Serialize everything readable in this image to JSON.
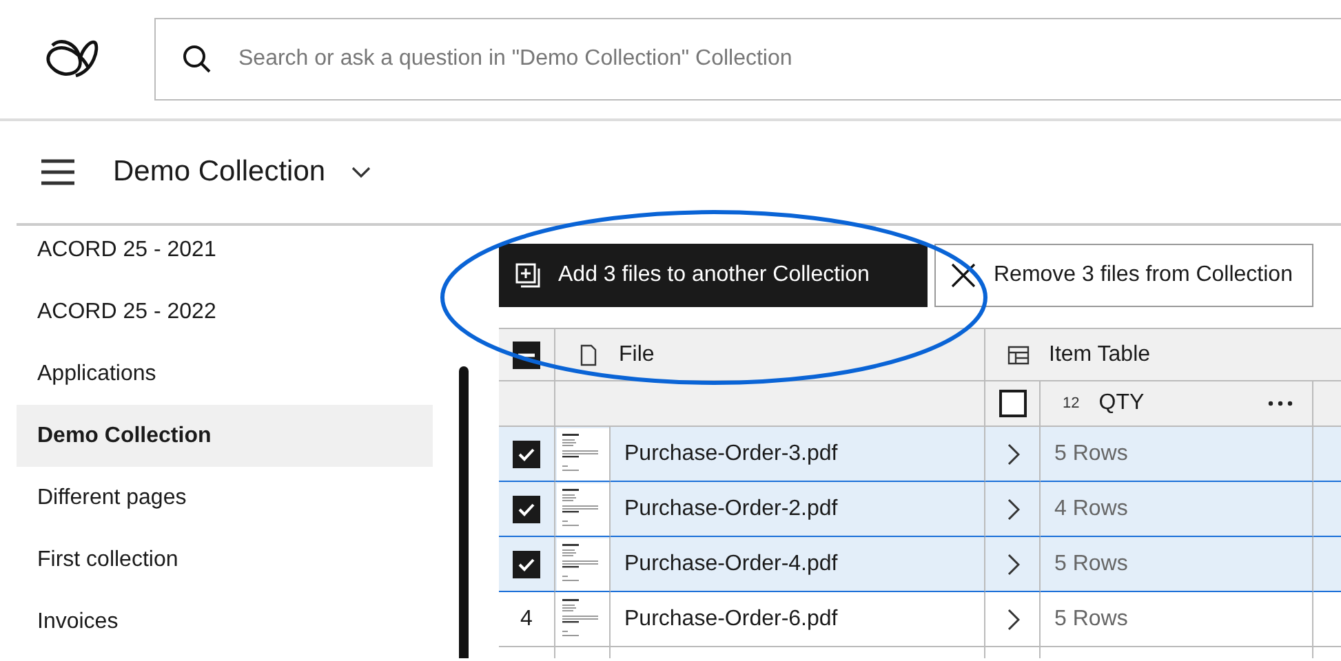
{
  "search": {
    "placeholder": "Search or ask a question in \"Demo Collection\" Collection"
  },
  "collection_title": "Demo Collection",
  "sidebar": {
    "items": [
      {
        "label": "ACORD 25 - 2021",
        "selected": false
      },
      {
        "label": "ACORD 25 - 2022",
        "selected": false
      },
      {
        "label": "Applications",
        "selected": false
      },
      {
        "label": "Demo Collection",
        "selected": true
      },
      {
        "label": "Different pages",
        "selected": false
      },
      {
        "label": "First collection",
        "selected": false
      },
      {
        "label": "Invoices",
        "selected": false
      }
    ]
  },
  "actions": [
    {
      "kind": "add",
      "label": "Add 3 files to another Collection"
    },
    {
      "kind": "remove",
      "label": "Remove 3 files from Collection"
    }
  ],
  "table": {
    "select_all": {
      "indeterminate": true
    },
    "columns": [
      {
        "kind": "file",
        "label": "File"
      },
      {
        "kind": "item_table",
        "label": "Item Table"
      }
    ],
    "subcolumn": {
      "type_label": "12",
      "label": "QTY",
      "checked": false
    },
    "rows": [
      {
        "selected": true,
        "file": "Purchase-Order-3.pdf",
        "item_table": "5 Rows"
      },
      {
        "selected": true,
        "file": "Purchase-Order-2.pdf",
        "item_table": "4 Rows"
      },
      {
        "selected": true,
        "file": "Purchase-Order-4.pdf",
        "item_table": "5 Rows"
      },
      {
        "selected": false,
        "number": "4",
        "file": "Purchase-Order-6.pdf",
        "item_table": "5 Rows"
      }
    ]
  },
  "annotation": {
    "kind": "ellipse",
    "color": "#0a64d6"
  }
}
